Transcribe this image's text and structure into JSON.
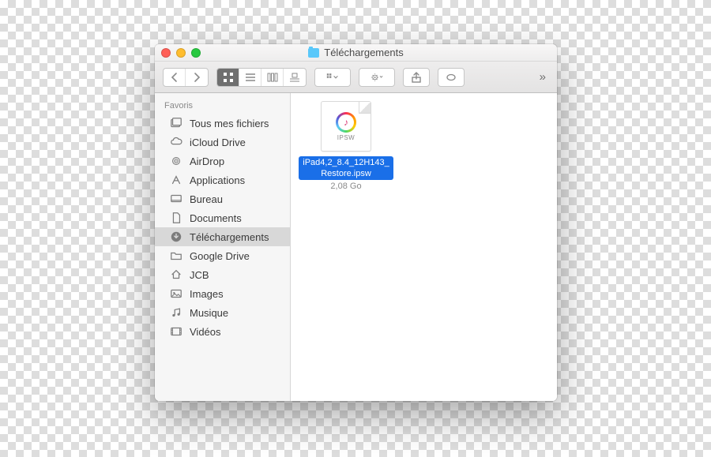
{
  "window": {
    "title": "Téléchargements"
  },
  "sidebar": {
    "header": "Favoris",
    "items": [
      {
        "label": "Tous mes fichiers",
        "icon": "all-files"
      },
      {
        "label": "iCloud Drive",
        "icon": "cloud"
      },
      {
        "label": "AirDrop",
        "icon": "airdrop"
      },
      {
        "label": "Applications",
        "icon": "apps"
      },
      {
        "label": "Bureau",
        "icon": "desktop"
      },
      {
        "label": "Documents",
        "icon": "documents"
      },
      {
        "label": "Téléchargements",
        "icon": "downloads",
        "selected": true
      },
      {
        "label": "Google Drive",
        "icon": "folder"
      },
      {
        "label": "JCB",
        "icon": "home"
      },
      {
        "label": "Images",
        "icon": "images"
      },
      {
        "label": "Musique",
        "icon": "music"
      },
      {
        "label": "Vidéos",
        "icon": "videos"
      }
    ]
  },
  "files": [
    {
      "name": "iPad4,2_8.4_12H143_Restore.ipsw",
      "size": "2,08 Go",
      "ext": "IPSW",
      "selected": true
    }
  ]
}
